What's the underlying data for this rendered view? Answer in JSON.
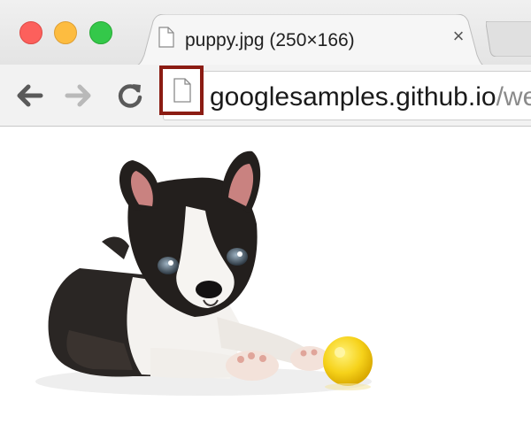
{
  "window": {
    "controls": [
      "close-button",
      "minimize-button",
      "zoom-button"
    ]
  },
  "tab": {
    "title": "puppy.jpg (250×166)",
    "close_glyph": "×",
    "favicon": "page-icon"
  },
  "toolbar": {
    "back_icon": "arrow-left-icon",
    "forward_icon": "arrow-right-icon",
    "reload_icon": "reload-icon"
  },
  "omnibox": {
    "site_icon": "page-icon",
    "url_host": "googlesamples.github.io",
    "url_path": "/we",
    "highlight_color": "#8b1c13"
  },
  "content": {
    "image": "puppy-photo"
  }
}
